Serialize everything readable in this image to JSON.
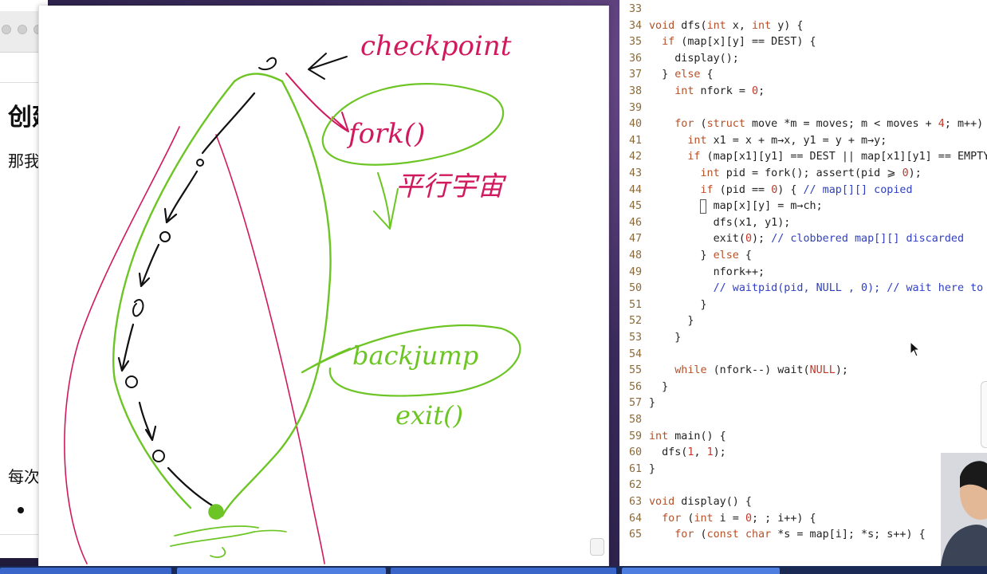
{
  "slide": {
    "heading": "创建",
    "paragraph": "那我",
    "each": "每次",
    "bullet": "●"
  },
  "whiteboard": {
    "annotations": {
      "checkpoint": "checkpoint",
      "fork": "fork()",
      "parallel": "平行宇宙",
      "backjump": "backjump",
      "exit": "exit()"
    },
    "colors": {
      "black": "#111111",
      "red": "#d1195e",
      "green": "#6cc524"
    }
  },
  "editor": {
    "lines": [
      {
        "n": "33",
        "html": ""
      },
      {
        "n": "34",
        "html": "<span class='tok-kw'>void</span> dfs(<span class='tok-kw'>int</span> x, <span class='tok-kw'>int</span> y) {"
      },
      {
        "n": "35",
        "html": "  <span class='tok-kw'>if</span> (map[x][y] == DEST) {"
      },
      {
        "n": "36",
        "html": "    display();"
      },
      {
        "n": "37",
        "html": "  } <span class='tok-kw'>else</span> {"
      },
      {
        "n": "38",
        "html": "    <span class='tok-kw'>int</span> nfork = <span class='tok-num'>0</span>;"
      },
      {
        "n": "39",
        "html": ""
      },
      {
        "n": "40",
        "html": "    <span class='tok-kw'>for</span> (<span class='tok-kw'>struct</span> move *m = moves; m &lt; moves + <span class='tok-num'>4</span>; m++)"
      },
      {
        "n": "41",
        "html": "      <span class='tok-kw'>int</span> x1 = x + m→x, y1 = y + m→y;"
      },
      {
        "n": "42",
        "html": "      <span class='tok-kw'>if</span> (map[x1][y1] == DEST || map[x1][y1] == EMPTY"
      },
      {
        "n": "43",
        "html": "        <span class='tok-kw'>int</span> pid = fork(); assert(pid ⩾ <span class='tok-num'>0</span>);"
      },
      {
        "n": "44",
        "html": "        <span class='tok-kw'>if</span> (pid == <span class='tok-num'>0</span>) { <span class='tok-cm'>// map[][] copied</span>"
      },
      {
        "n": "45",
        "html": "          map[x][y] = m→ch;"
      },
      {
        "n": "46",
        "html": "          dfs(x1, y1);"
      },
      {
        "n": "47",
        "html": "          exit(<span class='tok-num'>0</span>); <span class='tok-cm'>// clobbered map[][] discarded</span>"
      },
      {
        "n": "48",
        "html": "        } <span class='tok-kw'>else</span> {"
      },
      {
        "n": "49",
        "html": "          nfork++;"
      },
      {
        "n": "50",
        "html": "          <span class='tok-cm'>// waitpid(pid, NULL , 0); // wait here to</span>"
      },
      {
        "n": "51",
        "html": "        }"
      },
      {
        "n": "52",
        "html": "      }"
      },
      {
        "n": "53",
        "html": "    }"
      },
      {
        "n": "54",
        "html": ""
      },
      {
        "n": "55",
        "html": "    <span class='tok-kw'>while</span> (nfork--) wait(<span class='tok-num'>NULL</span>);"
      },
      {
        "n": "56",
        "html": "  }"
      },
      {
        "n": "57",
        "html": "}"
      },
      {
        "n": "58",
        "html": ""
      },
      {
        "n": "59",
        "html": "<span class='tok-kw'>int</span> main() {"
      },
      {
        "n": "60",
        "html": "  dfs(<span class='tok-num'>1</span>, <span class='tok-num'>1</span>);"
      },
      {
        "n": "61",
        "html": "}"
      },
      {
        "n": "62",
        "html": ""
      },
      {
        "n": "63",
        "html": "<span class='tok-kw'>void</span> display() {"
      },
      {
        "n": "64",
        "html": "  <span class='tok-kw'>for</span> (<span class='tok-kw'>int</span> i = <span class='tok-num'>0</span>; ; i++) {"
      },
      {
        "n": "65",
        "html": "    <span class='tok-kw'>for</span> (<span class='tok-kw'>const</span> <span class='tok-kw'>char</span> *s = map[i]; *s; s++) {"
      }
    ]
  }
}
